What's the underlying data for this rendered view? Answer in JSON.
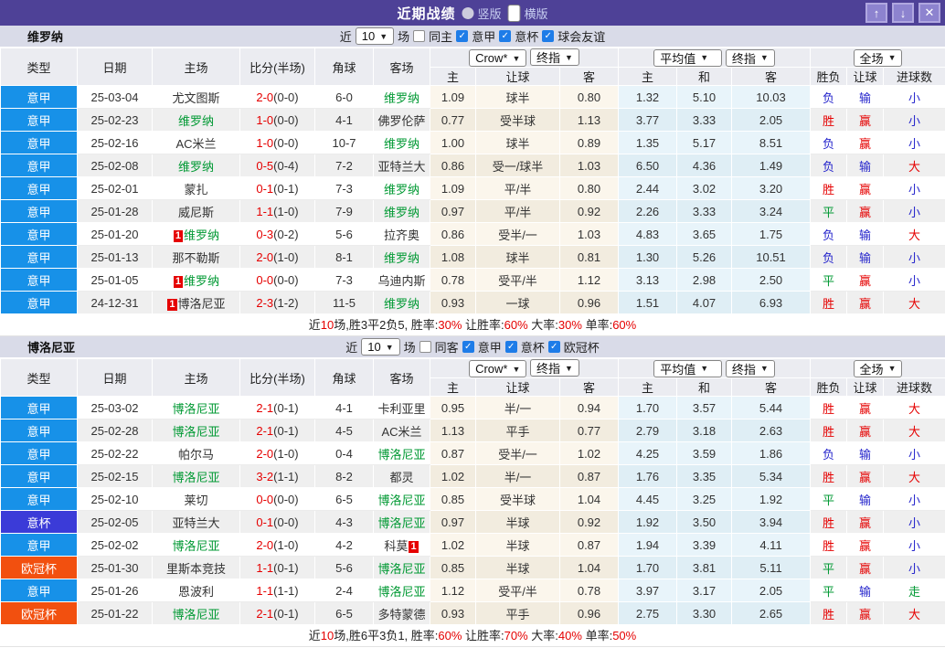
{
  "titlebar": {
    "title": "近期战绩",
    "view_options": [
      {
        "label": "竖版",
        "selected": false
      },
      {
        "label": "横版",
        "selected": true
      }
    ],
    "window_buttons": [
      {
        "name": "move-up-button",
        "glyph": "↑"
      },
      {
        "name": "move-down-button",
        "glyph": "↓"
      },
      {
        "name": "close-button",
        "glyph": "✕"
      }
    ]
  },
  "colors": {
    "titlebar": "#4e4197",
    "league": {
      "意甲": "#1791e8",
      "意杯": "#3b3bd8",
      "欧冠杯": "#f2500f"
    },
    "result": {
      "胜": "#e50000",
      "赢": "#e50000",
      "大": "#e50000",
      "负": "#2525cc",
      "输": "#2525cc",
      "小": "#2525cc",
      "平": "#009933",
      "走": "#009933"
    },
    "focus_team": "#009933",
    "score": "#e50000",
    "highlight": "#e50000"
  },
  "table_header": {
    "left_cols": [
      "类型",
      "日期",
      "主场",
      "比分(半场)",
      "角球",
      "客场"
    ],
    "odds_group_selects": [
      "Crow*",
      "终指"
    ],
    "odds_cols": [
      "主",
      "让球",
      "客"
    ],
    "avg_group_selects": [
      "平均值",
      "终指"
    ],
    "avg_cols": [
      "主",
      "和",
      "客"
    ],
    "result_group_selects": [
      "全场"
    ],
    "result_cols": [
      "胜负",
      "让球",
      "进球数"
    ]
  },
  "sections": [
    {
      "team": "维罗纳",
      "filter": {
        "near_label": "近",
        "count": "10",
        "games_label": "场",
        "checkboxes": [
          {
            "label": "同主",
            "checked": false
          },
          {
            "label": "意甲",
            "checked": true
          },
          {
            "label": "意杯",
            "checked": true
          },
          {
            "label": "球会友谊",
            "checked": true
          }
        ]
      },
      "rows": [
        {
          "lg": "意甲",
          "date": "25-03-04",
          "home": "尤文图斯",
          "hG": false,
          "hC": "",
          "score": "2-0",
          "half": "(0-0)",
          "cor": "6-0",
          "away": "维罗纳",
          "aG": true,
          "aC": "",
          "crow": [
            "1.09",
            "球半",
            "0.80"
          ],
          "avg": [
            "1.32",
            "5.10",
            "10.03"
          ],
          "res": [
            "负",
            "输",
            "小"
          ]
        },
        {
          "lg": "意甲",
          "date": "25-02-23",
          "home": "维罗纳",
          "hG": true,
          "hC": "",
          "score": "1-0",
          "half": "(0-0)",
          "cor": "4-1",
          "away": "佛罗伦萨",
          "aG": false,
          "aC": "",
          "crow": [
            "0.77",
            "受半球",
            "1.13"
          ],
          "avg": [
            "3.77",
            "3.33",
            "2.05"
          ],
          "res": [
            "胜",
            "赢",
            "小"
          ]
        },
        {
          "lg": "意甲",
          "date": "25-02-16",
          "home": "AC米兰",
          "hG": false,
          "hC": "",
          "score": "1-0",
          "half": "(0-0)",
          "cor": "10-7",
          "away": "维罗纳",
          "aG": true,
          "aC": "",
          "crow": [
            "1.00",
            "球半",
            "0.89"
          ],
          "avg": [
            "1.35",
            "5.17",
            "8.51"
          ],
          "res": [
            "负",
            "赢",
            "小"
          ]
        },
        {
          "lg": "意甲",
          "date": "25-02-08",
          "home": "维罗纳",
          "hG": true,
          "hC": "",
          "score": "0-5",
          "half": "(0-4)",
          "cor": "7-2",
          "away": "亚特兰大",
          "aG": false,
          "aC": "",
          "crow": [
            "0.86",
            "受一/球半",
            "1.03"
          ],
          "avg": [
            "6.50",
            "4.36",
            "1.49"
          ],
          "res": [
            "负",
            "输",
            "大"
          ]
        },
        {
          "lg": "意甲",
          "date": "25-02-01",
          "home": "蒙扎",
          "hG": false,
          "hC": "",
          "score": "0-1",
          "half": "(0-1)",
          "cor": "7-3",
          "away": "维罗纳",
          "aG": true,
          "aC": "",
          "crow": [
            "1.09",
            "平/半",
            "0.80"
          ],
          "avg": [
            "2.44",
            "3.02",
            "3.20"
          ],
          "res": [
            "胜",
            "赢",
            "小"
          ]
        },
        {
          "lg": "意甲",
          "date": "25-01-28",
          "home": "威尼斯",
          "hG": false,
          "hC": "",
          "score": "1-1",
          "half": "(1-0)",
          "cor": "7-9",
          "away": "维罗纳",
          "aG": true,
          "aC": "",
          "crow": [
            "0.97",
            "平/半",
            "0.92"
          ],
          "avg": [
            "2.26",
            "3.33",
            "3.24"
          ],
          "res": [
            "平",
            "赢",
            "小"
          ]
        },
        {
          "lg": "意甲",
          "date": "25-01-20",
          "home": "维罗纳",
          "hG": true,
          "hC": "1",
          "score": "0-3",
          "half": "(0-2)",
          "cor": "5-6",
          "away": "拉齐奥",
          "aG": false,
          "aC": "",
          "crow": [
            "0.86",
            "受半/一",
            "1.03"
          ],
          "avg": [
            "4.83",
            "3.65",
            "1.75"
          ],
          "res": [
            "负",
            "输",
            "大"
          ]
        },
        {
          "lg": "意甲",
          "date": "25-01-13",
          "home": "那不勒斯",
          "hG": false,
          "hC": "",
          "score": "2-0",
          "half": "(1-0)",
          "cor": "8-1",
          "away": "维罗纳",
          "aG": true,
          "aC": "",
          "crow": [
            "1.08",
            "球半",
            "0.81"
          ],
          "avg": [
            "1.30",
            "5.26",
            "10.51"
          ],
          "res": [
            "负",
            "输",
            "小"
          ]
        },
        {
          "lg": "意甲",
          "date": "25-01-05",
          "home": "维罗纳",
          "hG": true,
          "hC": "1",
          "score": "0-0",
          "half": "(0-0)",
          "cor": "7-3",
          "away": "乌迪内斯",
          "aG": false,
          "aC": "",
          "crow": [
            "0.78",
            "受平/半",
            "1.12"
          ],
          "avg": [
            "3.13",
            "2.98",
            "2.50"
          ],
          "res": [
            "平",
            "赢",
            "小"
          ]
        },
        {
          "lg": "意甲",
          "date": "24-12-31",
          "home": "博洛尼亚",
          "hG": false,
          "hC": "1",
          "score": "2-3",
          "half": "(1-2)",
          "cor": "11-5",
          "away": "维罗纳",
          "aG": true,
          "aC": "",
          "crow": [
            "0.93",
            "一球",
            "0.96"
          ],
          "avg": [
            "1.51",
            "4.07",
            "6.93"
          ],
          "res": [
            "胜",
            "赢",
            "大"
          ]
        }
      ],
      "summary": [
        [
          "近",
          0
        ],
        [
          "10",
          1
        ],
        [
          "场,胜3平2负5, 胜率:",
          0
        ],
        [
          "30%",
          1
        ],
        [
          " 让胜率:",
          0
        ],
        [
          "60%",
          1
        ],
        [
          " 大率:",
          0
        ],
        [
          "30%",
          1
        ],
        [
          " 单率:",
          0
        ],
        [
          "60%",
          1
        ]
      ]
    },
    {
      "team": "博洛尼亚",
      "filter": {
        "near_label": "近",
        "count": "10",
        "games_label": "场",
        "checkboxes": [
          {
            "label": "同客",
            "checked": false
          },
          {
            "label": "意甲",
            "checked": true
          },
          {
            "label": "意杯",
            "checked": true
          },
          {
            "label": "欧冠杯",
            "checked": true
          }
        ]
      },
      "rows": [
        {
          "lg": "意甲",
          "date": "25-03-02",
          "home": "博洛尼亚",
          "hG": true,
          "hC": "",
          "score": "2-1",
          "half": "(0-1)",
          "cor": "4-1",
          "away": "卡利亚里",
          "aG": false,
          "aC": "",
          "crow": [
            "0.95",
            "半/一",
            "0.94"
          ],
          "avg": [
            "1.70",
            "3.57",
            "5.44"
          ],
          "res": [
            "胜",
            "赢",
            "大"
          ]
        },
        {
          "lg": "意甲",
          "date": "25-02-28",
          "home": "博洛尼亚",
          "hG": true,
          "hC": "",
          "score": "2-1",
          "half": "(0-1)",
          "cor": "4-5",
          "away": "AC米兰",
          "aG": false,
          "aC": "",
          "crow": [
            "1.13",
            "平手",
            "0.77"
          ],
          "avg": [
            "2.79",
            "3.18",
            "2.63"
          ],
          "res": [
            "胜",
            "赢",
            "大"
          ]
        },
        {
          "lg": "意甲",
          "date": "25-02-22",
          "home": "帕尔马",
          "hG": false,
          "hC": "",
          "score": "2-0",
          "half": "(1-0)",
          "cor": "0-4",
          "away": "博洛尼亚",
          "aG": true,
          "aC": "",
          "crow": [
            "0.87",
            "受半/一",
            "1.02"
          ],
          "avg": [
            "4.25",
            "3.59",
            "1.86"
          ],
          "res": [
            "负",
            "输",
            "小"
          ]
        },
        {
          "lg": "意甲",
          "date": "25-02-15",
          "home": "博洛尼亚",
          "hG": true,
          "hC": "",
          "score": "3-2",
          "half": "(1-1)",
          "cor": "8-2",
          "away": "都灵",
          "aG": false,
          "aC": "",
          "crow": [
            "1.02",
            "半/一",
            "0.87"
          ],
          "avg": [
            "1.76",
            "3.35",
            "5.34"
          ],
          "res": [
            "胜",
            "赢",
            "大"
          ]
        },
        {
          "lg": "意甲",
          "date": "25-02-10",
          "home": "莱切",
          "hG": false,
          "hC": "",
          "score": "0-0",
          "half": "(0-0)",
          "cor": "6-5",
          "away": "博洛尼亚",
          "aG": true,
          "aC": "",
          "crow": [
            "0.85",
            "受半球",
            "1.04"
          ],
          "avg": [
            "4.45",
            "3.25",
            "1.92"
          ],
          "res": [
            "平",
            "输",
            "小"
          ]
        },
        {
          "lg": "意杯",
          "date": "25-02-05",
          "home": "亚特兰大",
          "hG": false,
          "hC": "",
          "score": "0-1",
          "half": "(0-0)",
          "cor": "4-3",
          "away": "博洛尼亚",
          "aG": true,
          "aC": "",
          "crow": [
            "0.97",
            "半球",
            "0.92"
          ],
          "avg": [
            "1.92",
            "3.50",
            "3.94"
          ],
          "res": [
            "胜",
            "赢",
            "小"
          ]
        },
        {
          "lg": "意甲",
          "date": "25-02-02",
          "home": "博洛尼亚",
          "hG": true,
          "hC": "",
          "score": "2-0",
          "half": "(1-0)",
          "cor": "4-2",
          "away": "科莫",
          "aG": false,
          "aC": "1",
          "crow": [
            "1.02",
            "半球",
            "0.87"
          ],
          "avg": [
            "1.94",
            "3.39",
            "4.11"
          ],
          "res": [
            "胜",
            "赢",
            "小"
          ]
        },
        {
          "lg": "欧冠杯",
          "date": "25-01-30",
          "home": "里斯本竞技",
          "hG": false,
          "hC": "",
          "score": "1-1",
          "half": "(0-1)",
          "cor": "5-6",
          "away": "博洛尼亚",
          "aG": true,
          "aC": "",
          "crow": [
            "0.85",
            "半球",
            "1.04"
          ],
          "avg": [
            "1.70",
            "3.81",
            "5.11"
          ],
          "res": [
            "平",
            "赢",
            "小"
          ]
        },
        {
          "lg": "意甲",
          "date": "25-01-26",
          "home": "恩波利",
          "hG": false,
          "hC": "",
          "score": "1-1",
          "half": "(1-1)",
          "cor": "2-4",
          "away": "博洛尼亚",
          "aG": true,
          "aC": "",
          "crow": [
            "1.12",
            "受平/半",
            "0.78"
          ],
          "avg": [
            "3.97",
            "3.17",
            "2.05"
          ],
          "res": [
            "平",
            "输",
            "走"
          ]
        },
        {
          "lg": "欧冠杯",
          "date": "25-01-22",
          "home": "博洛尼亚",
          "hG": true,
          "hC": "",
          "score": "2-1",
          "half": "(0-1)",
          "cor": "6-5",
          "away": "多特蒙德",
          "aG": false,
          "aC": "",
          "crow": [
            "0.93",
            "平手",
            "0.96"
          ],
          "avg": [
            "2.75",
            "3.30",
            "2.65"
          ],
          "res": [
            "胜",
            "赢",
            "大"
          ]
        }
      ],
      "summary": [
        [
          "近",
          0
        ],
        [
          "10",
          1
        ],
        [
          "场,胜6平3负1, 胜率:",
          0
        ],
        [
          "60%",
          1
        ],
        [
          " 让胜率:",
          0
        ],
        [
          "70%",
          1
        ],
        [
          " 大率:",
          0
        ],
        [
          "40%",
          1
        ],
        [
          " 单率:",
          0
        ],
        [
          "50%",
          1
        ]
      ]
    }
  ]
}
